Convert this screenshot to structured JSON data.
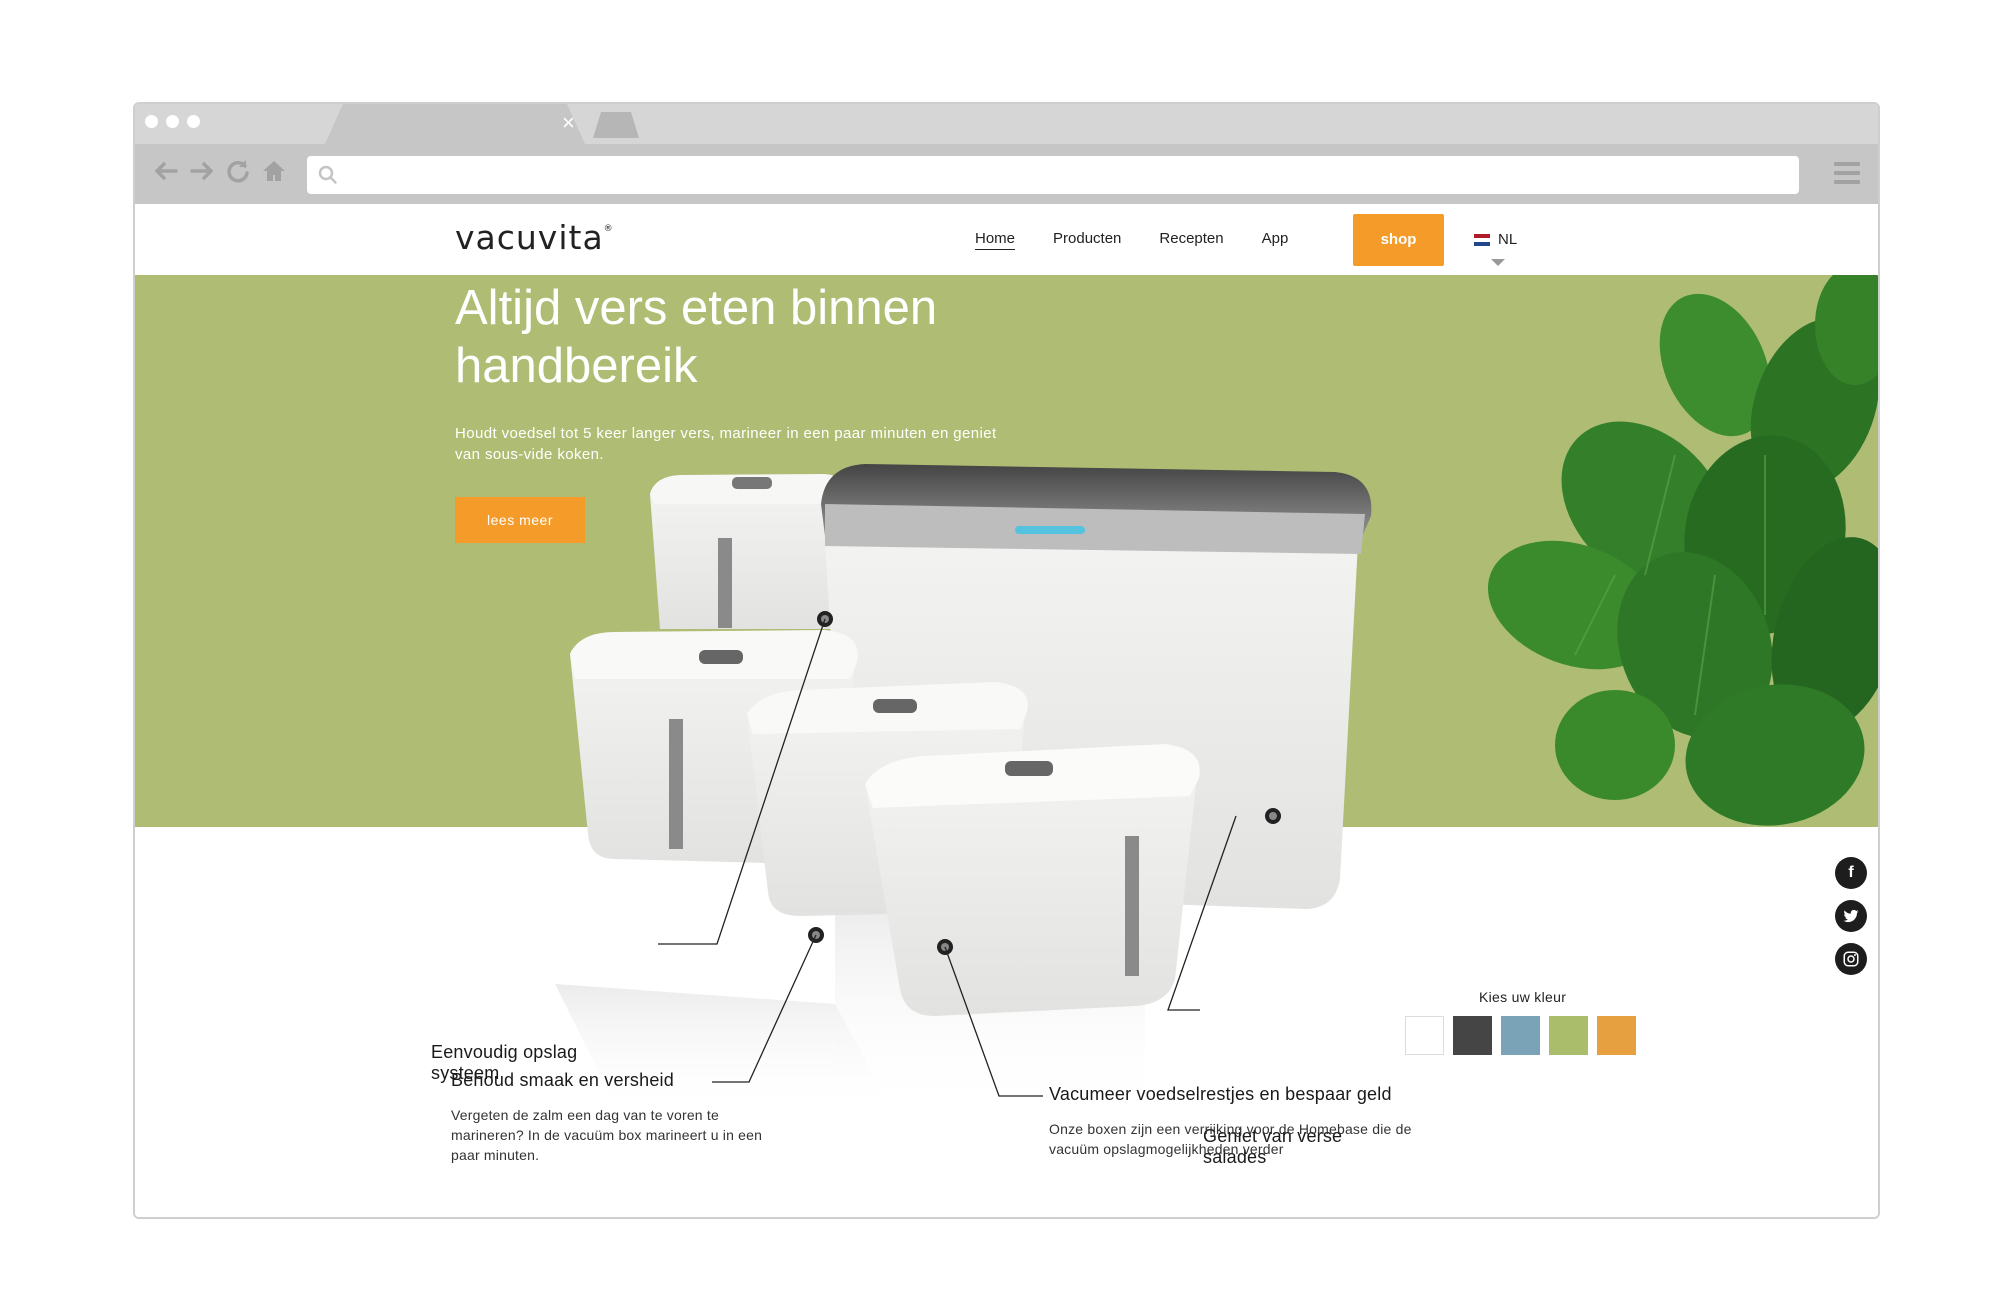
{
  "browser": {
    "tab_close": "×",
    "icons": [
      "back-icon",
      "forward-icon",
      "reload-icon",
      "home-icon",
      "search-icon",
      "menu-icon"
    ]
  },
  "site": {
    "logo": "vacuvita",
    "logo_mark": "®",
    "nav": [
      "Home",
      "Producten",
      "Recepten",
      "App"
    ],
    "shop_label": "shop",
    "language": "NL",
    "accent": "#f59b2a",
    "hero_color": "#aebd73"
  },
  "hero": {
    "title": "Altijd vers eten binnen handbereik",
    "subtitle": "Houdt voedsel tot 5 keer langer vers, marineer in een paar minuten en geniet van sous-vide koken.",
    "cta": "lees meer"
  },
  "colors": {
    "label": "Kies uw kleur",
    "swatches": [
      "#ffffff",
      "#454545",
      "#7ba3b8",
      "#a9bd6a",
      "#e6a03f"
    ]
  },
  "features": {
    "storage": "Eenvoudig opslag systeem",
    "salads": "Geniet van verse salades",
    "taste_title": "Behoud smaak en versheid",
    "taste_text": "Vergeten de zalm een dag van te voren te marineren? In de vacuüm box marineert u in een paar minuten.",
    "vacuum_title": "Vacumeer voedselrestjes en bespaar geld",
    "vacuum_text": "Onze boxen zijn een verrijking voor de Homebase die de vacuüm opslagmogelijkheden verder"
  },
  "social": [
    "facebook-icon",
    "twitter-icon",
    "instagram-icon"
  ]
}
